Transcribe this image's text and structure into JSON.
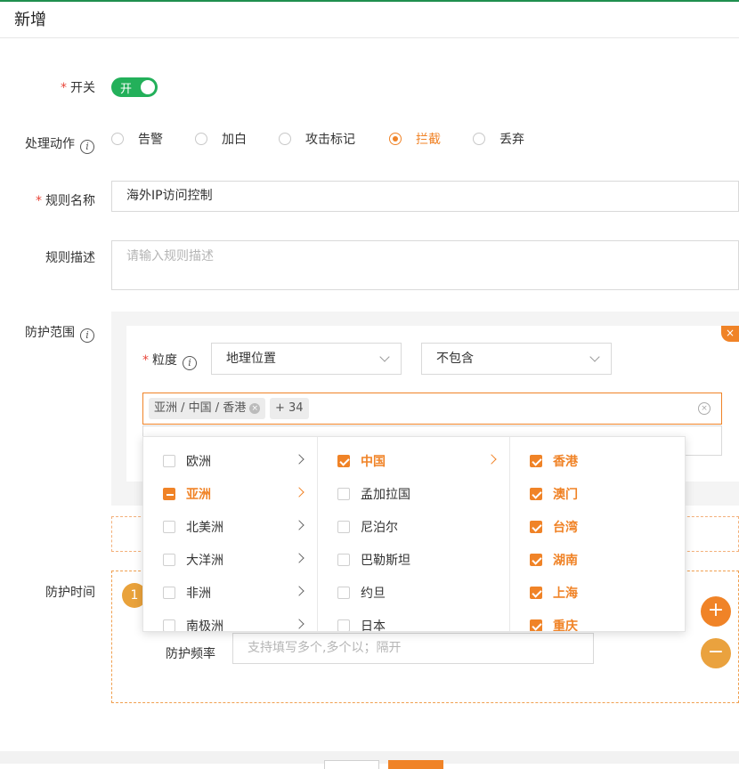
{
  "header": {
    "title": "新增"
  },
  "form": {
    "switch": {
      "label": "开关",
      "required": "*",
      "value": "开"
    },
    "action": {
      "label": "处理动作",
      "options": [
        "告警",
        "加白",
        "攻击标记",
        "拦截",
        "丢弃"
      ],
      "selected": "拦截"
    },
    "rule_name": {
      "label": "规则名称",
      "required": "*",
      "value": "海外IP访问控制"
    },
    "rule_desc": {
      "label": "规则描述",
      "placeholder": "请输入规则描述"
    },
    "scope": {
      "label": "防护范围",
      "granularity_label": "粒度",
      "required": "*",
      "granularity_value": "地理位置",
      "match_value": "不包含",
      "tags": [
        "亚洲 / 中国 / 香港",
        "+ 34"
      ]
    },
    "time": {
      "label": "防护时间",
      "index": "1",
      "freq_label": "防护频率",
      "freq_placeholder": "支持填写多个,多个以；隔开"
    }
  },
  "cascader": {
    "level1": [
      {
        "label": "欧洲",
        "state": "none"
      },
      {
        "label": "亚洲",
        "state": "half"
      },
      {
        "label": "北美洲",
        "state": "none"
      },
      {
        "label": "大洋洲",
        "state": "none"
      },
      {
        "label": "非洲",
        "state": "none"
      },
      {
        "label": "南极洲",
        "state": "none"
      }
    ],
    "level2": [
      {
        "label": "中国",
        "state": "checked"
      },
      {
        "label": "孟加拉国",
        "state": "none"
      },
      {
        "label": "尼泊尔",
        "state": "none"
      },
      {
        "label": "巴勒斯坦",
        "state": "none"
      },
      {
        "label": "约旦",
        "state": "none"
      },
      {
        "label": "日本",
        "state": "none"
      }
    ],
    "level3": [
      {
        "label": "香港",
        "state": "checked"
      },
      {
        "label": "澳门",
        "state": "checked"
      },
      {
        "label": "台湾",
        "state": "checked"
      },
      {
        "label": "湖南",
        "state": "checked"
      },
      {
        "label": "上海",
        "state": "checked"
      },
      {
        "label": "重庆",
        "state": "checked"
      }
    ]
  },
  "icons": {
    "close": "×",
    "plus": "+",
    "minus": "−",
    "clear": "×"
  },
  "colors": {
    "accent": "#f08327",
    "switch_on": "#23b05a",
    "required": "#e8463a"
  }
}
